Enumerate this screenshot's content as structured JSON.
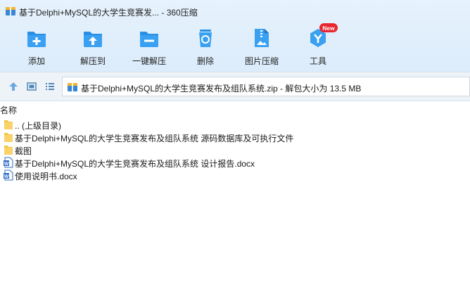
{
  "window": {
    "title": "基于Delphi+MySQL的大学生竞赛发... - 360压缩"
  },
  "toolbar": {
    "buttons": [
      {
        "label": "添加",
        "icon": "add-icon"
      },
      {
        "label": "解压到",
        "icon": "extract-to-icon"
      },
      {
        "label": "一键解压",
        "icon": "one-click-extract-icon"
      },
      {
        "label": "删除",
        "icon": "delete-icon"
      },
      {
        "label": "图片压缩",
        "icon": "image-compress-icon"
      },
      {
        "label": "工具",
        "icon": "tools-icon",
        "badge": "New"
      }
    ]
  },
  "addressbar": {
    "path": "基于Delphi+MySQL的大学生竞赛发布及组队系统.zip - 解包大小为 13.5 MB"
  },
  "list": {
    "column_name": "名称",
    "items": [
      {
        "name": ".. (上级目录)",
        "type": "folder"
      },
      {
        "name": "基于Delphi+MySQL的大学生竞赛发布及组队系统 源码数据库及可执行文件",
        "type": "folder"
      },
      {
        "name": "截图",
        "type": "folder"
      },
      {
        "name": "基于Delphi+MySQL的大学生竞赛发布及组队系统 设计报告.docx",
        "type": "docx"
      },
      {
        "name": "使用说明书.docx",
        "type": "docx"
      }
    ]
  },
  "colors": {
    "accent": "#2b8fe6",
    "toolbar_bg": "#e3f0fc",
    "badge": "#e8262d",
    "folder": "#f6c443"
  }
}
